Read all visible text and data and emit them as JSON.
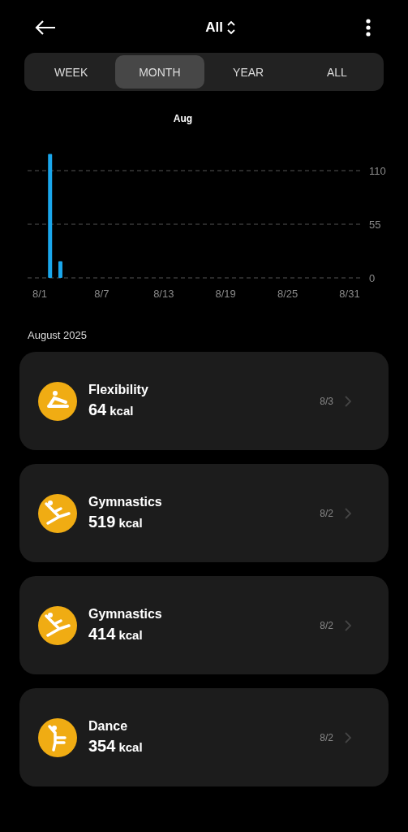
{
  "header": {
    "title": "All"
  },
  "tabs": [
    {
      "label": "WEEK",
      "selected": false
    },
    {
      "label": "MONTH",
      "selected": true
    },
    {
      "label": "YEAR",
      "selected": false
    },
    {
      "label": "ALL",
      "selected": false
    }
  ],
  "chart": {
    "chart_data": {
      "type": "bar",
      "title": "Aug",
      "ylim": [
        0,
        127
      ],
      "categories": [
        "8/1",
        null,
        null,
        null,
        null,
        null,
        "8/7",
        null,
        null,
        null,
        null,
        null,
        "8/13",
        null,
        null,
        null,
        null,
        null,
        "8/19",
        null,
        null,
        null,
        null,
        null,
        "8/25",
        null,
        null,
        null,
        null,
        null,
        "8/31"
      ],
      "values": [
        null,
        127,
        17,
        null,
        null,
        null,
        null,
        null,
        null,
        null,
        null,
        null,
        null,
        null,
        null,
        null,
        null,
        null,
        null,
        null,
        null,
        null,
        null,
        null,
        null,
        null,
        null,
        null,
        null,
        null,
        null
      ],
      "yticks": [
        0,
        55,
        110
      ]
    }
  },
  "section": {
    "title": "August 2025"
  },
  "activities": [
    {
      "kind": "flexibility",
      "name": "Flexibility",
      "value": "64",
      "unit": "kcal",
      "date": "8/3"
    },
    {
      "kind": "gymnastics",
      "name": "Gymnastics",
      "value": "519",
      "unit": "kcal",
      "date": "8/2"
    },
    {
      "kind": "gymnastics",
      "name": "Gymnastics",
      "value": "414",
      "unit": "kcal",
      "date": "8/2"
    },
    {
      "kind": "dance",
      "name": "Dance",
      "value": "354",
      "unit": "kcal",
      "date": "8/2"
    }
  ]
}
